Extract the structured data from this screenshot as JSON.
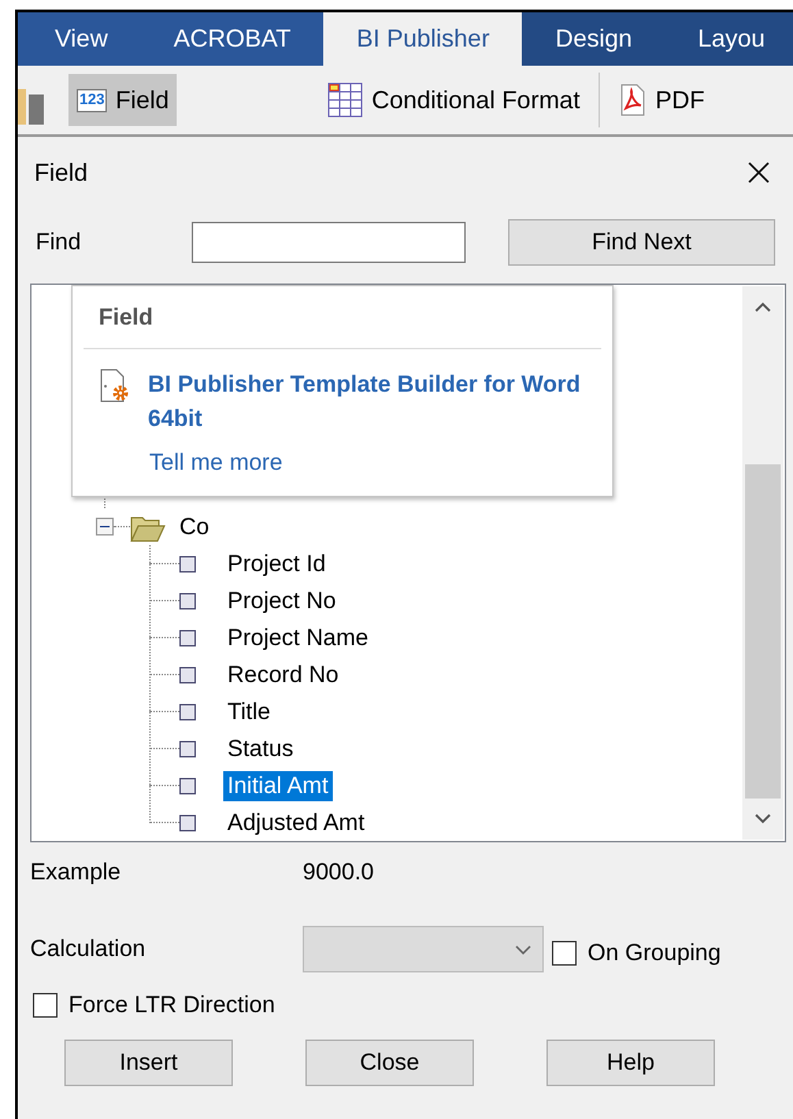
{
  "ribbon": {
    "tabs": [
      {
        "label": "View",
        "selected": false,
        "kind": "normal"
      },
      {
        "label": "ACROBAT",
        "selected": false,
        "kind": "normal"
      },
      {
        "label": "BI Publisher",
        "selected": true,
        "kind": "normal"
      },
      {
        "label": "Design",
        "selected": false,
        "kind": "contextual"
      },
      {
        "label": "Layou",
        "selected": false,
        "kind": "contextual"
      }
    ],
    "buttons": [
      {
        "label": "Field",
        "kind": "field",
        "badge": "123",
        "selected": true
      },
      {
        "label": "Conditional Format",
        "kind": "table",
        "selected": false
      },
      {
        "label": "PDF",
        "kind": "pdf",
        "selected": false
      }
    ]
  },
  "dialog": {
    "title": "Field",
    "find": {
      "label": "Find",
      "button": "Find Next"
    },
    "tooltip": {
      "title": "Field",
      "heading": "BI Publisher Template Builder for Word 64bit",
      "link": "Tell me more"
    },
    "tree": {
      "label": "Co",
      "expanded": true,
      "children": [
        {
          "label": "Project Id",
          "selected": false
        },
        {
          "label": "Project No",
          "selected": false
        },
        {
          "label": "Project Name",
          "selected": false
        },
        {
          "label": "Record No",
          "selected": false
        },
        {
          "label": "Title",
          "selected": false
        },
        {
          "label": "Status",
          "selected": false
        },
        {
          "label": "Initial Amt",
          "selected": true
        },
        {
          "label": "Adjusted Amt",
          "selected": false
        }
      ]
    },
    "example": {
      "label": "Example",
      "value": "9000.0"
    },
    "calculation": {
      "label": "Calculation",
      "disabled": true,
      "option": {
        "label": "On Grouping",
        "checked": false
      }
    },
    "force_ltr": {
      "label": "Force LTR Direction",
      "checked": false
    },
    "buttons": [
      "Insert",
      "Close",
      "Help"
    ]
  }
}
